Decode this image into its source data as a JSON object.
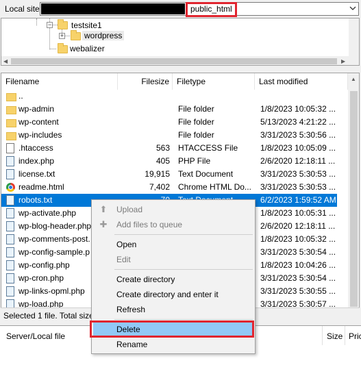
{
  "site_bar": {
    "label": "Local site:",
    "path_visible": "public_html"
  },
  "tree": {
    "items": [
      {
        "label": "testsite1",
        "expander": "−"
      },
      {
        "label": "wordpress",
        "expander": "+"
      },
      {
        "label": "webalizer"
      }
    ]
  },
  "file_list": {
    "columns": [
      "Filename",
      "Filesize",
      "Filetype",
      "Last modified"
    ],
    "rows": [
      {
        "name": "..",
        "size": "",
        "type": "",
        "modified": "",
        "icon": "folder-icon"
      },
      {
        "name": "wp-admin",
        "size": "",
        "type": "File folder",
        "modified": "1/8/2023 10:05:32 ...",
        "icon": "folder-icon"
      },
      {
        "name": "wp-content",
        "size": "",
        "type": "File folder",
        "modified": "5/13/2023 4:21:22 ...",
        "icon": "folder-icon"
      },
      {
        "name": "wp-includes",
        "size": "",
        "type": "File folder",
        "modified": "3/31/2023 5:30:56 ...",
        "icon": "folder-icon"
      },
      {
        "name": ".htaccess",
        "size": "563",
        "type": "HTACCESS File",
        "modified": "1/8/2023 10:05:09 ...",
        "icon": "document-icon"
      },
      {
        "name": "index.php",
        "size": "405",
        "type": "PHP File",
        "modified": "2/6/2020 12:18:11 ...",
        "icon": "php-file-icon"
      },
      {
        "name": "license.txt",
        "size": "19,915",
        "type": "Text Document",
        "modified": "3/31/2023 5:30:53 ...",
        "icon": "text-file-icon"
      },
      {
        "name": "readme.html",
        "size": "7,402",
        "type": "Chrome HTML Do...",
        "modified": "3/31/2023 5:30:53 ...",
        "icon": "chrome-icon"
      },
      {
        "name": "robots.txt",
        "size": "70",
        "type": "Text Document",
        "modified": "6/2/2023 1:59:52 AM",
        "icon": "text-file-icon",
        "selected": true
      },
      {
        "name": "wp-activate.php",
        "size": "",
        "type": "",
        "modified": "1/8/2023 10:05:31 ...",
        "icon": "php-file-icon"
      },
      {
        "name": "wp-blog-header.php",
        "size": "",
        "type": "",
        "modified": "2/6/2020 12:18:11 ...",
        "icon": "php-file-icon"
      },
      {
        "name": "wp-comments-post.",
        "size": "",
        "type": "",
        "modified": "1/8/2023 10:05:32 ...",
        "icon": "php-file-icon"
      },
      {
        "name": "wp-config-sample.p",
        "size": "",
        "type": "",
        "modified": "3/31/2023 5:30:54 ...",
        "icon": "php-file-icon"
      },
      {
        "name": "wp-config.php",
        "size": "",
        "type": "",
        "modified": "1/8/2023 10:04:26 ...",
        "icon": "php-file-icon"
      },
      {
        "name": "wp-cron.php",
        "size": "",
        "type": "",
        "modified": "3/31/2023 5:30:54 ...",
        "icon": "php-file-icon"
      },
      {
        "name": "wp-links-opml.php",
        "size": "",
        "type": "",
        "modified": "3/31/2023 5:30:55 ...",
        "icon": "php-file-icon"
      },
      {
        "name": "wp-load.php",
        "size": "",
        "type": "",
        "modified": "3/31/2023 5:30:57 ...",
        "icon": "php-file-icon"
      }
    ]
  },
  "status": {
    "text": "Selected 1 file. Total size:"
  },
  "queue": {
    "col_file": "Server/Local file",
    "col_size": "Size",
    "col_priority": "Pric"
  },
  "context_menu": {
    "upload": "Upload",
    "add_to_queue": "Add files to queue",
    "open": "Open",
    "edit": "Edit",
    "create_dir": "Create directory",
    "create_dir_enter": "Create directory and enter it",
    "refresh": "Refresh",
    "delete": "Delete",
    "rename": "Rename"
  },
  "colors": {
    "selection": "#0078d7",
    "highlight_border": "#e0252f",
    "menu_hover": "#91c9f7"
  }
}
